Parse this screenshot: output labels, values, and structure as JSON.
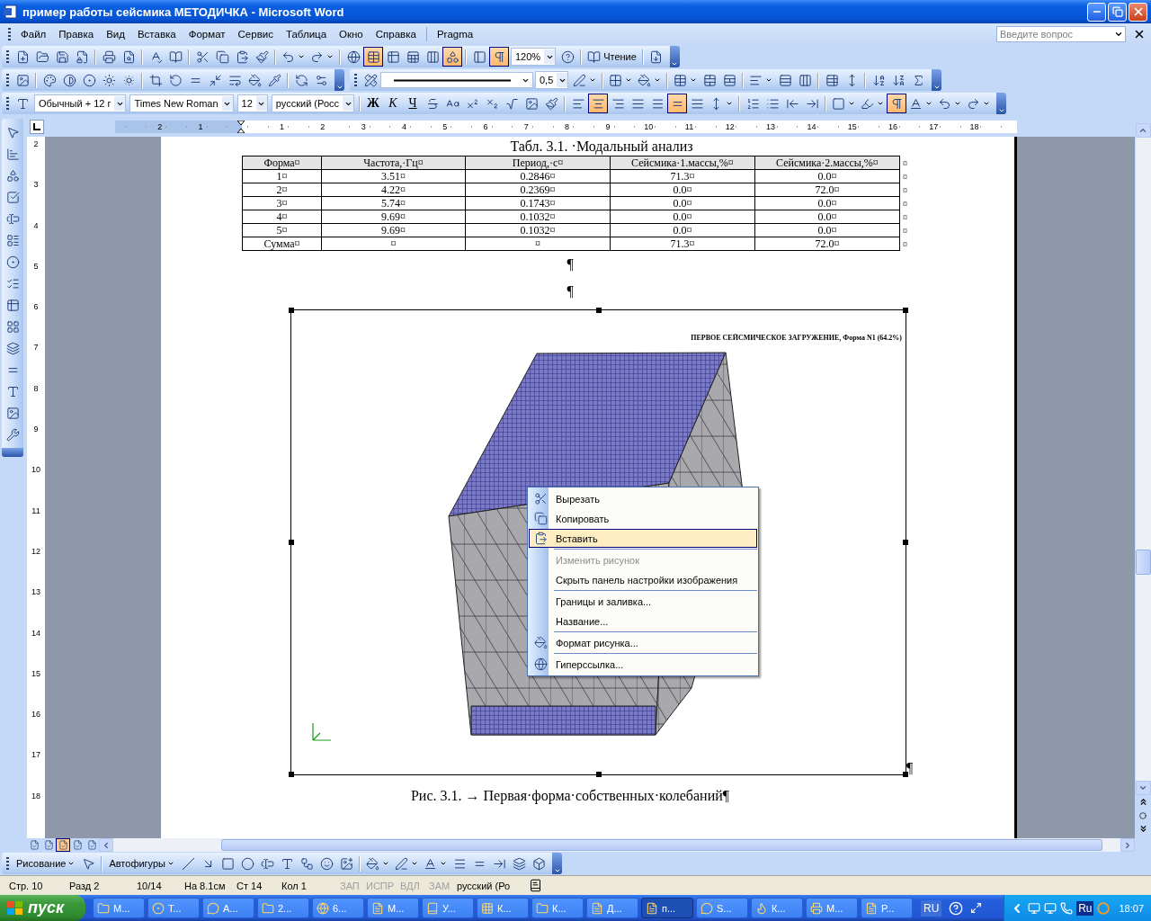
{
  "window": {
    "title": "пример работы сейсмика МЕТОДИЧКА - Microsoft Word"
  },
  "menu": {
    "items": [
      "Файл",
      "Правка",
      "Вид",
      "Вставка",
      "Формат",
      "Сервис",
      "Таблица",
      "Окно",
      "Справка"
    ],
    "addins": [
      "Pragma"
    ],
    "help_search": {
      "placeholder": "Введите вопрос"
    }
  },
  "toolbars": {
    "standard": [
      {
        "kind": "button",
        "on": false
      },
      {
        "kind": "button",
        "on": false
      },
      {
        "kind": "button",
        "on": false
      },
      {
        "kind": "button",
        "on": false
      },
      {
        "kind": "sep"
      },
      {
        "kind": "button",
        "on": false
      },
      {
        "kind": "button",
        "on": false
      },
      {
        "kind": "sep"
      },
      {
        "kind": "button",
        "on": false
      },
      {
        "kind": "button",
        "on": false
      },
      {
        "kind": "sep"
      },
      {
        "kind": "button",
        "on": false
      },
      {
        "kind": "button",
        "on": false
      },
      {
        "kind": "button",
        "on": false
      },
      {
        "kind": "button",
        "on": false
      },
      {
        "kind": "sep"
      },
      {
        "kind": "split",
        "on": false
      },
      {
        "kind": "split",
        "on": false
      },
      {
        "kind": "sep"
      },
      {
        "kind": "button",
        "on": false
      },
      {
        "kind": "button",
        "on": true
      },
      {
        "kind": "button",
        "on": false
      },
      {
        "kind": "button",
        "on": false
      },
      {
        "kind": "button",
        "on": false
      },
      {
        "kind": "button",
        "on": true
      },
      {
        "kind": "sep"
      },
      {
        "kind": "button",
        "on": false
      },
      {
        "kind": "button",
        "on": true
      },
      {
        "kind": "combo",
        "value": "120%"
      },
      {
        "kind": "button",
        "on": false
      },
      {
        "kind": "sep"
      },
      {
        "kind": "label",
        "label": "Чтение"
      },
      {
        "kind": "sep"
      },
      {
        "kind": "button",
        "on": false
      }
    ],
    "picture": [
      {
        "kind": "button",
        "on": false
      },
      {
        "kind": "sep"
      },
      {
        "kind": "button",
        "on": false
      },
      {
        "kind": "button",
        "on": false
      },
      {
        "kind": "button",
        "on": false
      },
      {
        "kind": "button",
        "on": false
      },
      {
        "kind": "button",
        "on": false
      },
      {
        "kind": "sep"
      },
      {
        "kind": "button",
        "on": false
      },
      {
        "kind": "button",
        "on": false
      },
      {
        "kind": "button",
        "on": false
      },
      {
        "kind": "button",
        "on": false
      },
      {
        "kind": "button",
        "on": false
      },
      {
        "kind": "button",
        "on": false
      },
      {
        "kind": "button",
        "on": false
      },
      {
        "kind": "sep"
      },
      {
        "kind": "button",
        "on": false
      },
      {
        "kind": "button",
        "on": false
      }
    ],
    "tables": [
      {
        "kind": "button",
        "on": false
      },
      {
        "kind": "linestyle"
      },
      {
        "kind": "combo",
        "value": "0,5"
      },
      {
        "kind": "split",
        "on": false
      },
      {
        "kind": "sep"
      },
      {
        "kind": "split",
        "on": false
      },
      {
        "kind": "split",
        "on": false
      },
      {
        "kind": "sep"
      },
      {
        "kind": "split",
        "on": false
      },
      {
        "kind": "button",
        "on": false
      },
      {
        "kind": "button",
        "on": false
      },
      {
        "kind": "sep"
      },
      {
        "kind": "split",
        "on": false
      },
      {
        "kind": "button",
        "on": false
      },
      {
        "kind": "button",
        "on": false
      },
      {
        "kind": "sep"
      },
      {
        "kind": "button",
        "on": false
      },
      {
        "kind": "button",
        "on": false
      },
      {
        "kind": "sep"
      },
      {
        "kind": "button",
        "on": false
      },
      {
        "kind": "button",
        "on": false
      },
      {
        "kind": "button",
        "on": false
      }
    ],
    "formatting": [
      {
        "kind": "button",
        "on": false
      },
      {
        "kind": "combo",
        "value": "Обычный + 12 г"
      },
      {
        "kind": "combo",
        "value": "Times New Roman"
      },
      {
        "kind": "combo",
        "value": "12"
      },
      {
        "kind": "combo",
        "value": "русский (Росс"
      },
      {
        "kind": "sep"
      },
      {
        "kind": "bold",
        "label": "Ж",
        "on": false
      },
      {
        "kind": "italic",
        "label": "К",
        "on": false
      },
      {
        "kind": "underline",
        "label": "Ч",
        "on": false
      },
      {
        "kind": "button",
        "on": false
      },
      {
        "kind": "button",
        "on": false
      },
      {
        "kind": "button",
        "on": false
      },
      {
        "kind": "button",
        "on": false
      },
      {
        "kind": "button",
        "on": false
      },
      {
        "kind": "button",
        "on": false
      },
      {
        "kind": "button",
        "on": false
      },
      {
        "kind": "sep"
      },
      {
        "kind": "button",
        "on": false
      },
      {
        "kind": "button",
        "on": true
      },
      {
        "kind": "button",
        "on": false
      },
      {
        "kind": "button",
        "on": false
      },
      {
        "kind": "button",
        "on": false
      },
      {
        "kind": "button",
        "on": true
      },
      {
        "kind": "button",
        "on": false
      },
      {
        "kind": "split",
        "on": false
      },
      {
        "kind": "sep"
      },
      {
        "kind": "button",
        "on": false
      },
      {
        "kind": "button",
        "on": false
      },
      {
        "kind": "button",
        "on": false
      },
      {
        "kind": "button",
        "on": false
      },
      {
        "kind": "sep"
      },
      {
        "kind": "split",
        "on": false
      },
      {
        "kind": "split",
        "on": false
      },
      {
        "kind": "button",
        "on": true
      },
      {
        "kind": "split",
        "on": false
      },
      {
        "kind": "split",
        "on": false
      },
      {
        "kind": "split",
        "on": false
      }
    ],
    "drawing": [
      {
        "kind": "menu",
        "label": "Рисование"
      },
      {
        "kind": "button",
        "on": false
      },
      {
        "kind": "sep"
      },
      {
        "kind": "menu",
        "label": "Автофигуры"
      },
      {
        "kind": "button",
        "on": false
      },
      {
        "kind": "button",
        "on": false
      },
      {
        "kind": "button",
        "on": false
      },
      {
        "kind": "button",
        "on": false
      },
      {
        "kind": "button",
        "on": false
      },
      {
        "kind": "button",
        "on": false
      },
      {
        "kind": "button",
        "on": false
      },
      {
        "kind": "button",
        "on": false
      },
      {
        "kind": "button",
        "on": false
      },
      {
        "kind": "sep"
      },
      {
        "kind": "split",
        "on": false
      },
      {
        "kind": "split",
        "on": false
      },
      {
        "kind": "split",
        "on": false
      },
      {
        "kind": "button",
        "on": false
      },
      {
        "kind": "button",
        "on": false
      },
      {
        "kind": "button",
        "on": false
      },
      {
        "kind": "button",
        "on": false
      },
      {
        "kind": "button",
        "on": false
      }
    ]
  },
  "ruler": {
    "left_numbers": [
      "2",
      "1"
    ],
    "numbers": [
      "1",
      "2",
      "3",
      "4",
      "5",
      "6",
      "7",
      "8",
      "9",
      "10",
      "11",
      "12",
      "13",
      "14",
      "15",
      "16",
      "17",
      "18"
    ]
  },
  "vertical_ruler": {
    "numbers": [
      "2",
      "3",
      "4",
      "5",
      "6",
      "7",
      "8",
      "9",
      "10",
      "11",
      "12",
      "13",
      "14",
      "15",
      "16",
      "17",
      "18"
    ]
  },
  "document": {
    "table_caption": "Табл. 3.1. ·Модальный анализ",
    "table": {
      "header": {
        "cells": [
          "Форма¤",
          "Частота,·Гц¤",
          "Период,·с¤",
          "Сейсмика·1.массы,%¤",
          "Сейсмика·2.массы,%¤"
        ],
        "end": "¤"
      },
      "rows": [
        {
          "cells": [
            "1¤",
            "3.51¤",
            "0.2846¤",
            "71.3¤",
            "0.0¤"
          ],
          "end": "¤"
        },
        {
          "cells": [
            "2¤",
            "4.22¤",
            "0.2369¤",
            "0.0¤",
            "72.0¤"
          ],
          "end": "¤"
        },
        {
          "cells": [
            "3¤",
            "5.74¤",
            "0.1743¤",
            "0.0¤",
            "0.0¤"
          ],
          "end": "¤"
        },
        {
          "cells": [
            "4¤",
            "9.69¤",
            "0.1032¤",
            "0.0¤",
            "0.0¤"
          ],
          "end": "¤"
        },
        {
          "cells": [
            "5¤",
            "9.69¤",
            "0.1032¤",
            "0.0¤",
            "0.0¤"
          ],
          "end": "¤"
        },
        {
          "cells": [
            "Сумма¤",
            "¤",
            "¤",
            "71.3¤",
            "72.0¤"
          ],
          "end": "¤"
        }
      ]
    },
    "empty_paragraphs": [
      "¶",
      "¶"
    ],
    "picture": {
      "title": "ПЕРВОЕ СЕЙСМИЧЕСКОЕ ЗАГРУЖЕНИЕ, Форма N1 (64.2%)",
      "selected": true,
      "end_mark": "¶"
    },
    "figure_caption": "Рис. 3.1. → Первая·форма·собственных·колебаний¶"
  },
  "context_menu": [
    {
      "kind": "cut",
      "label": "Вырезать",
      "selected": false,
      "disabled": false
    },
    {
      "kind": "copy",
      "label": "Копировать",
      "selected": false,
      "disabled": false
    },
    {
      "kind": "paste",
      "label": "Вставить",
      "selected": true,
      "disabled": false
    },
    {
      "kind": "separator"
    },
    {
      "kind": "plain",
      "label": "Изменить рисунок",
      "selected": false,
      "disabled": true
    },
    {
      "kind": "plain",
      "label": "Скрыть панель настройки изображения",
      "selected": false,
      "disabled": false
    },
    {
      "kind": "separator"
    },
    {
      "kind": "plain",
      "label": "Границы и заливка...",
      "selected": false,
      "disabled": false
    },
    {
      "kind": "plain",
      "label": "Название...",
      "selected": false,
      "disabled": false
    },
    {
      "kind": "separator"
    },
    {
      "kind": "format",
      "label": "Формат рисунка...",
      "selected": false,
      "disabled": false
    },
    {
      "kind": "separator"
    },
    {
      "kind": "link",
      "label": "Гиперссылка...",
      "selected": false,
      "disabled": false
    }
  ],
  "view_buttons": [
    {
      "on": false
    },
    {
      "on": false
    },
    {
      "on": true
    },
    {
      "on": false
    },
    {
      "on": false
    }
  ],
  "status_bar": [
    {
      "text": "Стр. 10",
      "disabled": false
    },
    {
      "text": "Разд 2",
      "disabled": false
    },
    {
      "text": "10/14",
      "disabled": false
    },
    {
      "text": "На 8.1см",
      "disabled": false
    },
    {
      "text": "Ст 14",
      "disabled": false
    },
    {
      "text": "Кол 1",
      "disabled": false
    },
    {
      "text": "ЗАП",
      "disabled": true
    },
    {
      "text": "ИСПР",
      "disabled": true
    },
    {
      "text": "ВДЛ",
      "disabled": true
    },
    {
      "text": "ЗАМ",
      "disabled": true
    },
    {
      "text": "русский (Ро",
      "disabled": false
    }
  ],
  "taskbar": {
    "start": "пуск",
    "tasks": [
      {
        "kind": "explorer",
        "label": "М...",
        "selected": false
      },
      {
        "kind": "disc",
        "label": "Т...",
        "selected": false
      },
      {
        "kind": "chat",
        "label": "А...",
        "selected": false
      },
      {
        "kind": "folder",
        "label": "2...",
        "selected": false
      },
      {
        "kind": "browser",
        "label": "6...",
        "selected": false
      },
      {
        "kind": "word",
        "label": "М...",
        "selected": false
      },
      {
        "kind": "book",
        "label": "У...",
        "selected": false
      },
      {
        "kind": "grid",
        "label": "К...",
        "selected": false
      },
      {
        "kind": "folder",
        "label": "К...",
        "selected": false
      },
      {
        "kind": "word",
        "label": "Д...",
        "selected": false
      },
      {
        "kind": "word",
        "label": "п...",
        "selected": true
      },
      {
        "kind": "chat",
        "label": "S...",
        "selected": false
      },
      {
        "kind": "fox",
        "label": "К...",
        "selected": false
      },
      {
        "kind": "printer",
        "label": "М...",
        "selected": false
      },
      {
        "kind": "word",
        "label": "Р...",
        "selected": false
      }
    ],
    "language": "RU",
    "tray_language": "Ru",
    "time": "18:07"
  }
}
